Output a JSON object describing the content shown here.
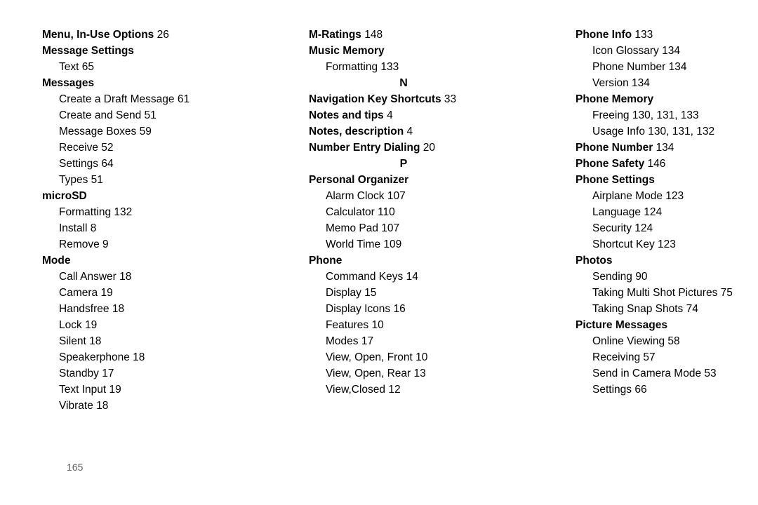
{
  "page_number": "165",
  "columns": [
    [
      {
        "type": "top",
        "bold": "Menu, In-Use Options",
        "page": "26"
      },
      {
        "type": "top",
        "bold": "Message Settings",
        "page": ""
      },
      {
        "type": "sub",
        "text": "Text",
        "page": "65"
      },
      {
        "type": "top",
        "bold": "Messages",
        "page": ""
      },
      {
        "type": "sub",
        "text": "Create a Draft Message",
        "page": "61"
      },
      {
        "type": "sub",
        "text": "Create and Send",
        "page": "51"
      },
      {
        "type": "sub",
        "text": "Message Boxes",
        "page": "59"
      },
      {
        "type": "sub",
        "text": "Receive",
        "page": "52"
      },
      {
        "type": "sub",
        "text": "Settings",
        "page": "64"
      },
      {
        "type": "sub",
        "text": "Types",
        "page": "51"
      },
      {
        "type": "top",
        "bold": "microSD",
        "page": ""
      },
      {
        "type": "sub",
        "text": "Formatting",
        "page": "132"
      },
      {
        "type": "sub",
        "text": "Install",
        "page": "8"
      },
      {
        "type": "sub",
        "text": "Remove",
        "page": "9"
      },
      {
        "type": "top",
        "bold": "Mode",
        "page": ""
      },
      {
        "type": "sub",
        "text": "Call Answer",
        "page": "18"
      },
      {
        "type": "sub",
        "text": "Camera",
        "page": "19"
      },
      {
        "type": "sub",
        "text": "Handsfree",
        "page": "18"
      },
      {
        "type": "sub",
        "text": "Lock",
        "page": "19"
      },
      {
        "type": "sub",
        "text": "Silent",
        "page": "18"
      },
      {
        "type": "sub",
        "text": "Speakerphone",
        "page": "18"
      },
      {
        "type": "sub",
        "text": "Standby",
        "page": "17"
      },
      {
        "type": "sub",
        "text": "Text Input",
        "page": "19"
      },
      {
        "type": "sub",
        "text": "Vibrate",
        "page": "18"
      }
    ],
    [
      {
        "type": "top",
        "bold": "M-Ratings",
        "page": "148"
      },
      {
        "type": "top",
        "bold": "Music Memory",
        "page": ""
      },
      {
        "type": "sub",
        "text": "Formatting",
        "page": "133"
      },
      {
        "type": "letter",
        "text": "N"
      },
      {
        "type": "top",
        "bold": "Navigation Key Shortcuts",
        "page": "33"
      },
      {
        "type": "top",
        "bold": "Notes and tips",
        "page": "4"
      },
      {
        "type": "top",
        "bold": "Notes, description",
        "page": "4"
      },
      {
        "type": "top",
        "bold": "Number Entry Dialing",
        "page": "20"
      },
      {
        "type": "letter",
        "text": "P"
      },
      {
        "type": "top",
        "bold": "Personal Organizer",
        "page": ""
      },
      {
        "type": "sub",
        "text": "Alarm Clock",
        "page": "107"
      },
      {
        "type": "sub",
        "text": "Calculator",
        "page": "110"
      },
      {
        "type": "sub",
        "text": "Memo Pad",
        "page": "107"
      },
      {
        "type": "sub",
        "text": "World Time",
        "page": "109"
      },
      {
        "type": "top",
        "bold": "Phone",
        "page": ""
      },
      {
        "type": "sub",
        "text": "Command Keys",
        "page": "14"
      },
      {
        "type": "sub",
        "text": "Display",
        "page": "15"
      },
      {
        "type": "sub",
        "text": "Display Icons",
        "page": "16"
      },
      {
        "type": "sub",
        "text": "Features",
        "page": "10"
      },
      {
        "type": "sub",
        "text": "Modes",
        "page": "17"
      },
      {
        "type": "sub",
        "text": "View, Open, Front",
        "page": "10"
      },
      {
        "type": "sub",
        "text": "View, Open, Rear",
        "page": "13"
      },
      {
        "type": "sub",
        "text": "View,Closed",
        "page": "12"
      }
    ],
    [
      {
        "type": "top",
        "bold": "Phone Info",
        "page": "133"
      },
      {
        "type": "sub",
        "text": "Icon Glossary",
        "page": "134"
      },
      {
        "type": "sub",
        "text": "Phone Number",
        "page": "134"
      },
      {
        "type": "sub",
        "text": "Version",
        "page": "134"
      },
      {
        "type": "top",
        "bold": "Phone Memory",
        "page": ""
      },
      {
        "type": "sub",
        "text": "Freeing",
        "page": "130, 131, 133"
      },
      {
        "type": "sub",
        "text": "Usage Info",
        "page": "130, 131, 132"
      },
      {
        "type": "top",
        "bold": "Phone Number",
        "page": "134"
      },
      {
        "type": "top",
        "bold": "Phone Safety",
        "page": "146"
      },
      {
        "type": "top",
        "bold": "Phone Settings",
        "page": ""
      },
      {
        "type": "sub",
        "text": "Airplane Mode",
        "page": "123"
      },
      {
        "type": "sub",
        "text": "Language",
        "page": "124"
      },
      {
        "type": "sub",
        "text": "Security",
        "page": "124"
      },
      {
        "type": "sub",
        "text": "Shortcut Key",
        "page": "123"
      },
      {
        "type": "top",
        "bold": "Photos",
        "page": ""
      },
      {
        "type": "sub",
        "text": "Sending",
        "page": "90"
      },
      {
        "type": "sub",
        "text": "Taking Multi Shot Pictures",
        "page": "75"
      },
      {
        "type": "sub",
        "text": "Taking Snap Shots",
        "page": "74"
      },
      {
        "type": "top",
        "bold": "Picture Messages",
        "page": ""
      },
      {
        "type": "sub",
        "text": "Online Viewing",
        "page": "58"
      },
      {
        "type": "sub",
        "text": "Receiving",
        "page": "57"
      },
      {
        "type": "sub",
        "text": "Send in Camera Mode",
        "page": "53"
      },
      {
        "type": "sub",
        "text": "Settings",
        "page": "66"
      }
    ]
  ]
}
